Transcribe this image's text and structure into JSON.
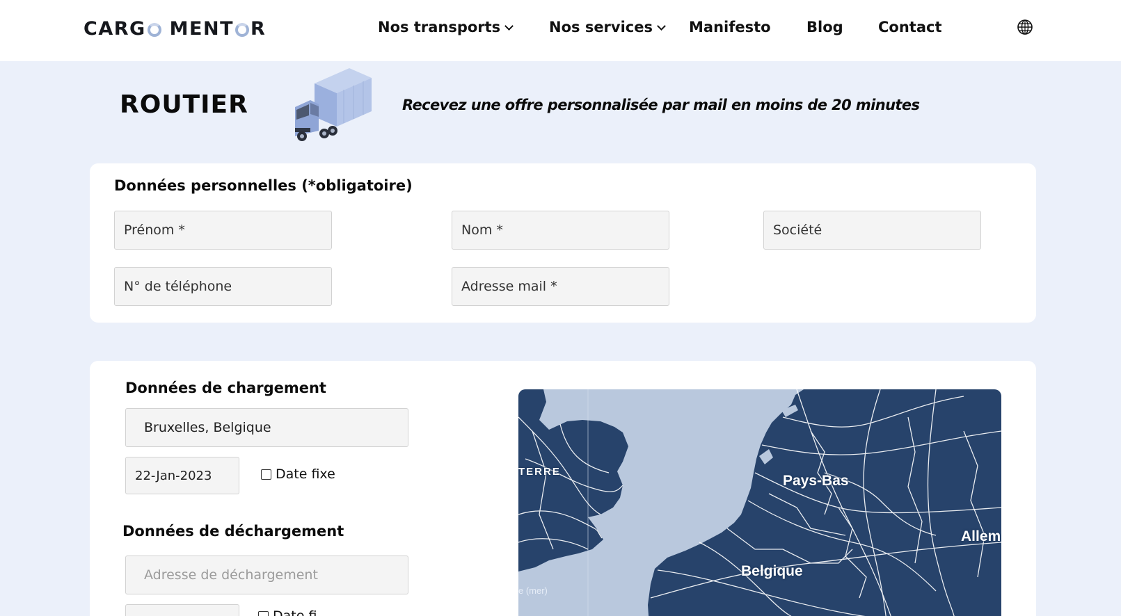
{
  "header": {
    "logo": {
      "part1": "CARG",
      "part2": "MENT",
      "part3": "R"
    },
    "nav": [
      {
        "label": "Nos transports",
        "dropdown": true
      },
      {
        "label": "Nos services",
        "dropdown": true
      },
      {
        "label": "Manifesto",
        "dropdown": false
      },
      {
        "label": "Blog",
        "dropdown": false
      },
      {
        "label": "Contact",
        "dropdown": false
      }
    ],
    "language_icon": "globe-icon"
  },
  "hero": {
    "title": "ROUTIER",
    "image": "truck-illustration",
    "tagline": "Recevez une offre personnalisée par mail en moins de 20 minutes"
  },
  "personal": {
    "title": "Données personnelles (*obligatoire)",
    "fields": {
      "first_name": {
        "placeholder": "Prénom *"
      },
      "last_name": {
        "placeholder": "Nom *"
      },
      "company": {
        "placeholder": "Société"
      },
      "phone": {
        "placeholder": "N° de téléphone"
      },
      "email": {
        "placeholder": "Adresse mail *"
      }
    }
  },
  "loading": {
    "title": "Données de chargement",
    "address_value": "Bruxelles, Belgique",
    "date_value": "22-Jan-2023",
    "fixed_date_label": "Date fixe"
  },
  "unloading": {
    "title": "Données de déchargement",
    "address_placeholder": "Adresse de déchargement",
    "fixed_date_label": "Date fi"
  },
  "map": {
    "labels": {
      "england": "TERRE",
      "netherlands": "Pays-Bas",
      "belgium": "Belgique",
      "germany": "Allem",
      "sea": "e (mer)"
    },
    "colors": {
      "land": "#27436b",
      "water": "#b9c8dd",
      "roads": "#ffffff"
    }
  },
  "colors": {
    "page_bg": "#ebf0fa",
    "card_bg": "#ffffff",
    "field_bg": "#f4f4f4",
    "accent": "#9fb3d6"
  }
}
